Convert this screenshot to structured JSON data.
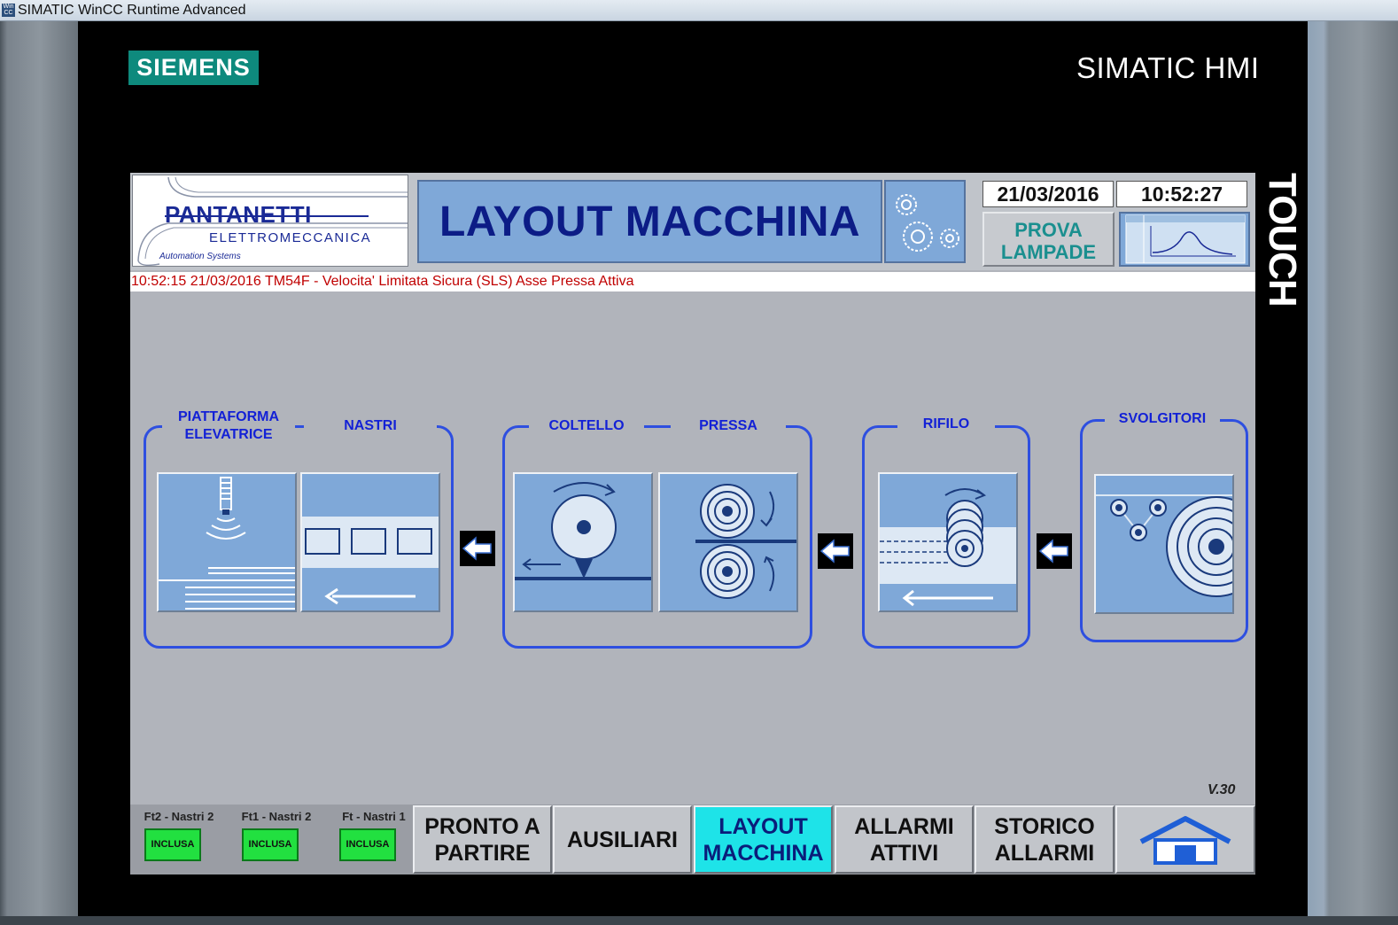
{
  "window": {
    "title": "SIMATIC WinCC Runtime Advanced",
    "app_icon_text": "Win CC"
  },
  "frame": {
    "brand": "SIEMENS",
    "product": "SIMATIC HMI",
    "touch_label": "TOUCH"
  },
  "header": {
    "logo": {
      "company": "PANTANETTI",
      "subtitle": "ELETTROMECCANICA",
      "tagline": "Automation Systems"
    },
    "screen_title": "LAYOUT MACCHINA",
    "date": "21/03/2016",
    "time": "10:52:27",
    "prova_lampade": "PROVA\nLAMPADE"
  },
  "alarm_line": "10:52:15   21/03/2016   TM54F - Velocita' Limitata Sicura (SLS) Asse Pressa Attiva",
  "layout": {
    "groups": [
      {
        "titles": [
          "PIATTAFORMA ELEVATRICE",
          "NASTRI"
        ]
      },
      {
        "titles": [
          "COLTELLO",
          "PRESSA"
        ]
      },
      {
        "titles": [
          "RIFILO"
        ]
      },
      {
        "titles": [
          "SVOLGITORI"
        ]
      }
    ],
    "version": "V.30"
  },
  "photocells": [
    {
      "label": "Ft2 - Nastri 2",
      "state": "INCLUSA"
    },
    {
      "label": "Ft1 - Nastri 2",
      "state": "INCLUSA"
    },
    {
      "label": "Ft - Nastri 1",
      "state": "INCLUSA"
    }
  ],
  "nav": {
    "pronto": "PRONTO A\nPARTIRE",
    "ausiliari": "AUSILIARI",
    "layout": "LAYOUT\nMACCHINA",
    "allarmi_attivi": "ALLARMI\nATTIVI",
    "storico_allarmi": "STORICO\nALLARMI"
  },
  "colors": {
    "accent_blue": "#1321d6",
    "tile_blue": "#7fa8d8",
    "active_nav": "#1ee3e8",
    "included_green": "#22e040",
    "alarm_red": "#c00000"
  }
}
